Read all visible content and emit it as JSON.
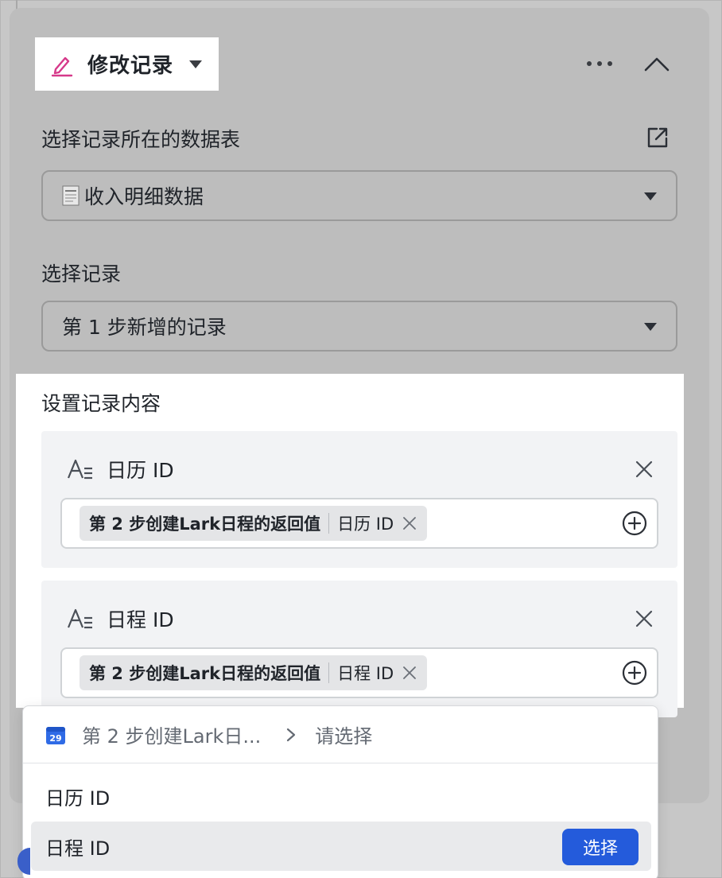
{
  "step": {
    "title": "修改记录"
  },
  "table_section": {
    "label": "选择记录所在的数据表",
    "selected": "收入明细数据"
  },
  "record_section": {
    "label": "选择记录",
    "selected": "第 1 步新增的记录"
  },
  "content_section": {
    "label": "设置记录内容",
    "fields": [
      {
        "name": "日历 ID",
        "token_source": "第 2 步创建Lark日程的返回值",
        "token_field": "日历 ID"
      },
      {
        "name": "日程 ID",
        "token_source": "第 2 步创建Lark日程的返回值",
        "token_field": "日程 ID"
      }
    ]
  },
  "dropdown": {
    "calendar_day": "29",
    "breadcrumb_source": "第 2 步创建Lark日...",
    "breadcrumb_current": "请选择",
    "items": [
      {
        "label": "日历 ID"
      },
      {
        "label": "日程 ID"
      }
    ],
    "choose_label": "选择"
  },
  "colors": {
    "accent": "#245bdb",
    "pen": "#d6398a",
    "calendar": "#2f6be6"
  }
}
